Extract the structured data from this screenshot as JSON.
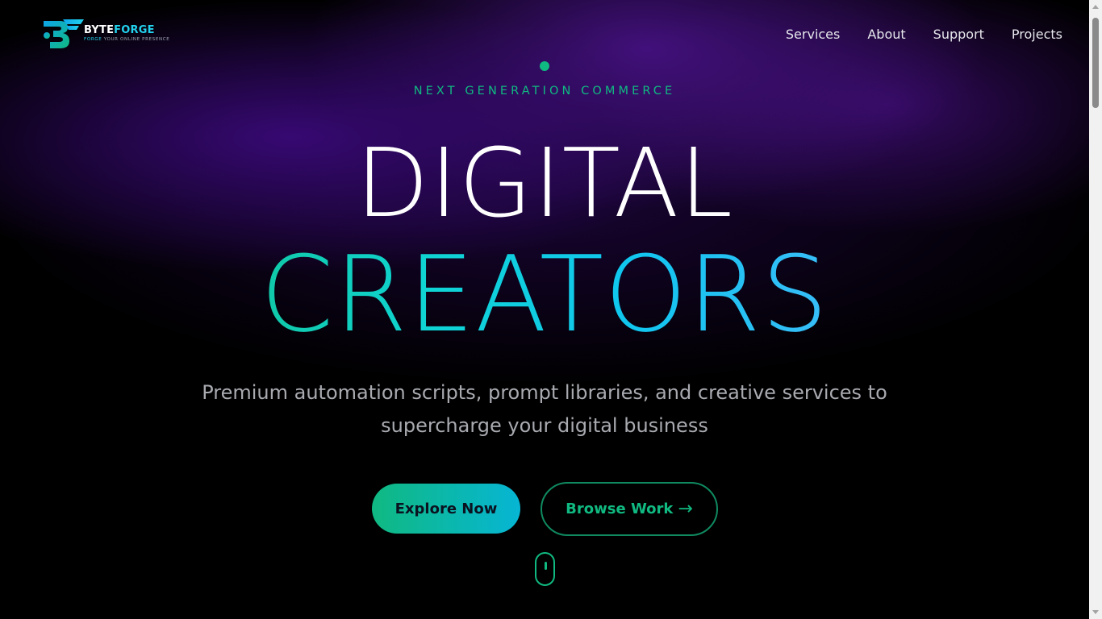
{
  "brand": {
    "name_part1": "BYTE",
    "name_part2": "FORGE",
    "tagline_part1": "FORGE",
    "tagline_part2": " YOUR ONLINE PRESENCE"
  },
  "nav": {
    "items": [
      {
        "label": "Services"
      },
      {
        "label": "About"
      },
      {
        "label": "Support"
      },
      {
        "label": "Projects"
      }
    ]
  },
  "hero": {
    "eyebrow": "NEXT GENERATION COMMERCE",
    "title_line1": "DIGITAL",
    "title_line2": "CREATORS",
    "subtitle": "Premium automation scripts, prompt libraries, and creative services to supercharge your digital business",
    "primary_cta": "Explore Now",
    "secondary_cta": "Browse Work",
    "secondary_cta_arrow": "→"
  },
  "colors": {
    "accent_green": "#10b981",
    "accent_cyan": "#22d3ee",
    "background": "#000000",
    "glow_purple": "#3e0a82"
  },
  "icons": {
    "scroll_indicator": "mouse-scroll-icon",
    "status_dot": "dot-icon"
  }
}
